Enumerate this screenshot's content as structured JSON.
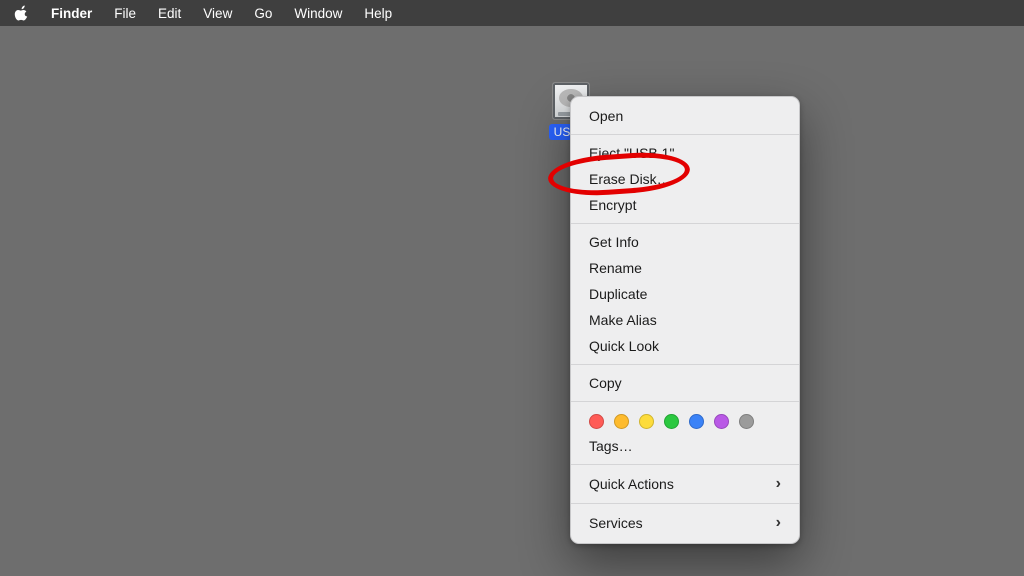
{
  "menubar": {
    "app_name": "Finder",
    "items": [
      "File",
      "Edit",
      "View",
      "Go",
      "Window",
      "Help"
    ]
  },
  "desktop": {
    "drive_label": "USB 1"
  },
  "context_menu": {
    "group1": {
      "open": "Open"
    },
    "group2": {
      "eject": "Eject \"USB 1\"",
      "erase": "Erase Disk…",
      "encrypt": "Encrypt"
    },
    "group3": {
      "getinfo": "Get Info",
      "rename": "Rename",
      "duplicate": "Duplicate",
      "alias": "Make Alias",
      "quicklook": "Quick Look"
    },
    "group4": {
      "copy": "Copy"
    },
    "tags_label": "Tags…",
    "tag_colors": [
      "#ff5b56",
      "#febb2e",
      "#fddc3b",
      "#2bc840",
      "#3a82f7",
      "#b959e6",
      "#9b9b9b"
    ],
    "group5": {
      "quickactions": "Quick Actions",
      "services": "Services"
    }
  }
}
